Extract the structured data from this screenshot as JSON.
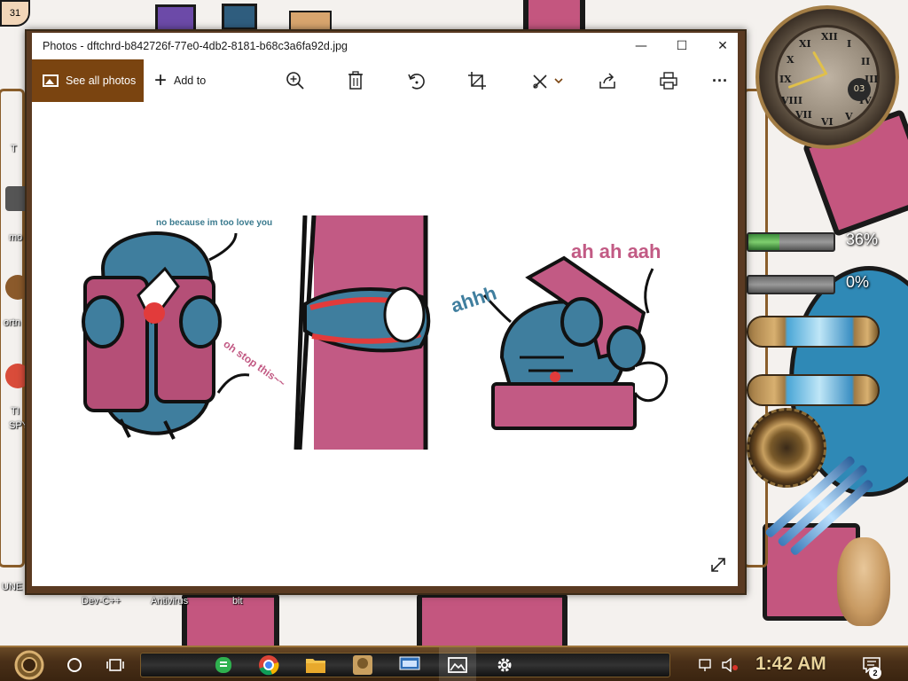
{
  "window": {
    "title": "Photos - dftchrd-b842726f-77e0-4db2-8181-b68c3a6fa92d.jpg",
    "minimize_glyph": "—",
    "maximize_glyph": "☐",
    "close_glyph": "✕"
  },
  "toolbar": {
    "see_all_label": "See all photos",
    "add_to_label": "Add to",
    "icons": [
      "zoom-in-icon",
      "delete-icon",
      "rotate-icon",
      "crop-icon",
      "edit-create-icon",
      "share-icon",
      "print-icon",
      "more-icon"
    ],
    "more_glyph": "···",
    "accent": "#7a4410"
  },
  "photo": {
    "bubble_1": "no because im too love you",
    "bubble_2": "oh stop this~~",
    "bubble_3": "ahhh",
    "bubble_4": "ah ah aah"
  },
  "desktop": {
    "labels": [
      "Dev-C++",
      "Antivirus",
      "bit",
      "T",
      "mo",
      "ortn",
      "TI",
      "SPY",
      "UNE"
    ],
    "meter_1": "36%",
    "meter_1_level": 36,
    "meter_2": "0%",
    "meter_2_level": 0,
    "clock_numerals": [
      "XII",
      "I",
      "II",
      "III",
      "IV",
      "V",
      "VI",
      "VII",
      "VIII",
      "IX",
      "X",
      "XI"
    ],
    "clock_date": "03",
    "corner_badge": "31"
  },
  "taskbar": {
    "time": "1:42 AM",
    "notification_count": "2",
    "apps": [
      "search-cortana-icon",
      "task-view-icon",
      "sheets-icon",
      "chrome-icon",
      "file-explorer-icon",
      "game-app-icon",
      "keyboard-app-icon",
      "photos-icon",
      "settings-icon"
    ],
    "accent": "#e9d39a"
  }
}
